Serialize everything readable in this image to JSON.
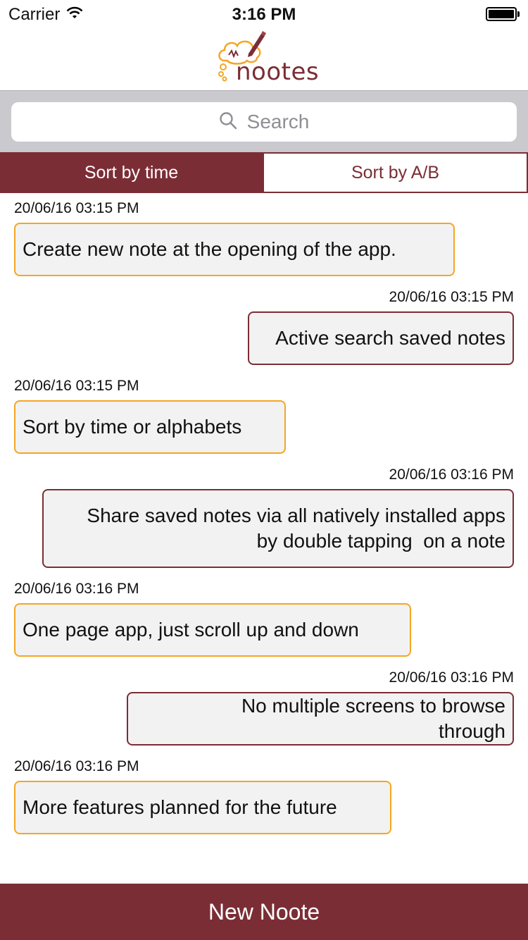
{
  "status_bar": {
    "carrier": "Carrier",
    "time": "3:16 PM"
  },
  "header": {
    "logo_text": "nootes"
  },
  "search": {
    "placeholder": "Search"
  },
  "sort": {
    "time_label": "Sort by time",
    "alpha_label": "Sort by A/B",
    "selected": "Sort by time"
  },
  "notes": [
    {
      "timestamp": "20/06/16 03:15 PM",
      "lines": [
        "Create new note at the opening of the app."
      ],
      "align": "left"
    },
    {
      "timestamp": "20/06/16 03:15 PM",
      "lines": [
        "Active search saved notes"
      ],
      "align": "right"
    },
    {
      "timestamp": "20/06/16 03:15 PM",
      "lines": [
        "Sort by time or alphabets"
      ],
      "align": "left"
    },
    {
      "timestamp": "20/06/16 03:16 PM",
      "lines": [
        "Share saved notes via all natively installed apps",
        "by double tapping  on a note"
      ],
      "align": "right"
    },
    {
      "timestamp": "20/06/16 03:16 PM",
      "lines": [
        "One page app, just scroll up and down"
      ],
      "align": "left"
    },
    {
      "timestamp": "20/06/16 03:16 PM",
      "lines": [
        "No multiple screens to browse",
        "through"
      ],
      "align": "right"
    },
    {
      "timestamp": "20/06/16 03:16 PM",
      "lines": [
        "More features planned for the future"
      ],
      "align": "left"
    }
  ],
  "footer": {
    "new_note_label": "New Noote"
  },
  "colors": {
    "brand": "#7b2d35",
    "accent": "#f5a623",
    "bubble_bg": "#f2f2f2"
  },
  "icons": [
    "wifi-icon",
    "battery-icon",
    "search-icon",
    "logo-cloud-icon",
    "pen-icon"
  ]
}
